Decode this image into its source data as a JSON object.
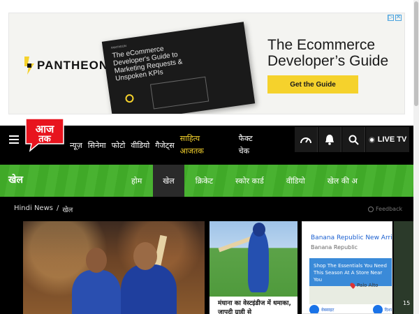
{
  "ad_banner": {
    "brand": "PANTHEON",
    "book_small": "PANTHEON",
    "book_title": "The eCommerce Developer's Guide to Marketing Requests & Unspoken KPIs",
    "headline_line1": "The Ecommerce",
    "headline_line2": "Developer’s Guide",
    "cta": "Get the Guide",
    "close_icons": [
      "info-icon",
      "close-icon"
    ]
  },
  "nav": {
    "items": [
      "न्यूज़",
      "सिनेमा",
      "फोटो",
      "वीडियो",
      "गैजेट्स"
    ],
    "highlight_line1": "साहित्य",
    "highlight_line2": "आजतक",
    "fact_line1": "फैक्ट",
    "fact_line2": "चेक",
    "live_tv": "LIVE TV",
    "logo_alt": "आज तक"
  },
  "subnav": {
    "title": "खेल",
    "items": [
      "होम",
      "खेल",
      "क्रिकेट",
      "स्कोर कार्ड",
      "वीडियो",
      "खेल की अ"
    ],
    "active_index": 1
  },
  "breadcrumb": {
    "home": "Hindi News",
    "separator": "/",
    "current": "खेल"
  },
  "feedback": "Feedback",
  "cards": {
    "second_caption": "मंधाना का वेस्टइंडीज में धमाका, जापदी ग्राही से"
  },
  "side_ad": {
    "title": "Banana Republic New Arrivals",
    "subtitle": "Banana Republic",
    "box_text": "Shop The Essentials You Need This Season At A Store Near You",
    "location": "Palo Alto",
    "btn_left": "वेबसाइट",
    "btn_right": "दिशा"
  },
  "edge_number": "15",
  "colors": {
    "nav_bg": "#000000",
    "subnav_green": "#43b02a",
    "highlight_yellow": "#f5d22c",
    "logo_red": "#e8141e",
    "cta_yellow": "#f5d22c"
  }
}
